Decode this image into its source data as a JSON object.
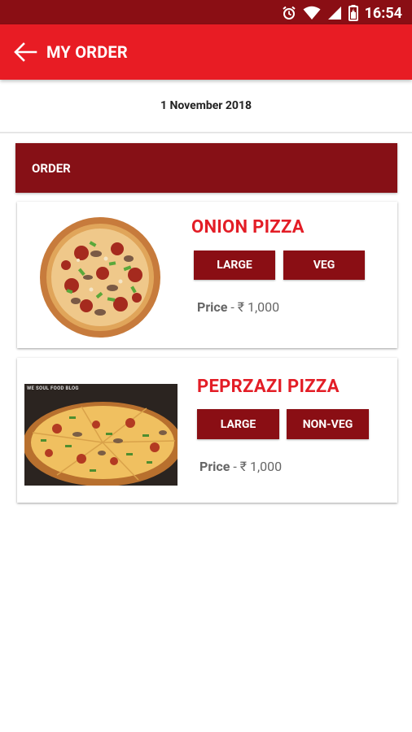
{
  "status_bar": {
    "time": "16:54",
    "icons": [
      "alarm-icon",
      "wifi-icon",
      "signal-icon",
      "battery-icon"
    ]
  },
  "app_bar": {
    "title": "MY ORDER",
    "back_icon": "arrow-left-icon"
  },
  "date": "1 November 2018",
  "order_header": "ORDER",
  "orders": [
    {
      "name": "ONION PIZZA",
      "size": "LARGE",
      "type": "VEG",
      "price_label": "Price",
      "price_separator": "-",
      "price_value": "₹ 1,000"
    },
    {
      "name": "PEPRZAZI PIZZA",
      "size": "LARGE",
      "type": "NON-VEG",
      "price_label": "Price",
      "price_separator": "-",
      "price_value": "₹ 1,000",
      "image_watermark": "WE SOUL FOOD BLOG"
    }
  ],
  "colors": {
    "status_bar": "#8a0e14",
    "app_bar": "#e81c24",
    "header": "#861016",
    "accent_text": "#e31d26",
    "tag_button": "#8a0e14"
  }
}
